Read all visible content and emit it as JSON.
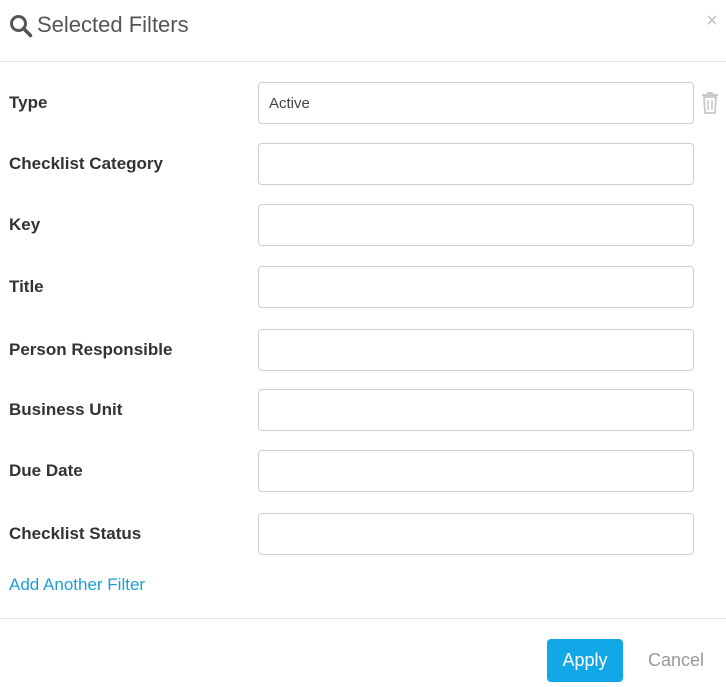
{
  "header": {
    "title": "Selected Filters",
    "close_glyph": "×"
  },
  "filters": [
    {
      "label": "Type",
      "value": "Active",
      "placeholder": ""
    },
    {
      "label": "Checklist Category",
      "value": "",
      "placeholder": ""
    },
    {
      "label": "Key",
      "value": "",
      "placeholder": ""
    },
    {
      "label": "Title",
      "value": "",
      "placeholder": ""
    },
    {
      "label": "Person Responsible",
      "value": "",
      "placeholder": ""
    },
    {
      "label": "Business Unit",
      "value": "",
      "placeholder": ""
    },
    {
      "label": "Due Date",
      "value": "",
      "placeholder": ""
    },
    {
      "label": "Checklist Status",
      "value": "",
      "placeholder": ""
    }
  ],
  "add_filter_label": "Add Another Filter",
  "footer": {
    "apply_label": "Apply",
    "cancel_label": "Cancel"
  },
  "colors": {
    "accent": "#12a8e8",
    "link": "#1a9fd6",
    "muted": "#999999"
  },
  "icons": {
    "header": "search-icon",
    "close": "close-icon",
    "remove": "trash-icon"
  }
}
